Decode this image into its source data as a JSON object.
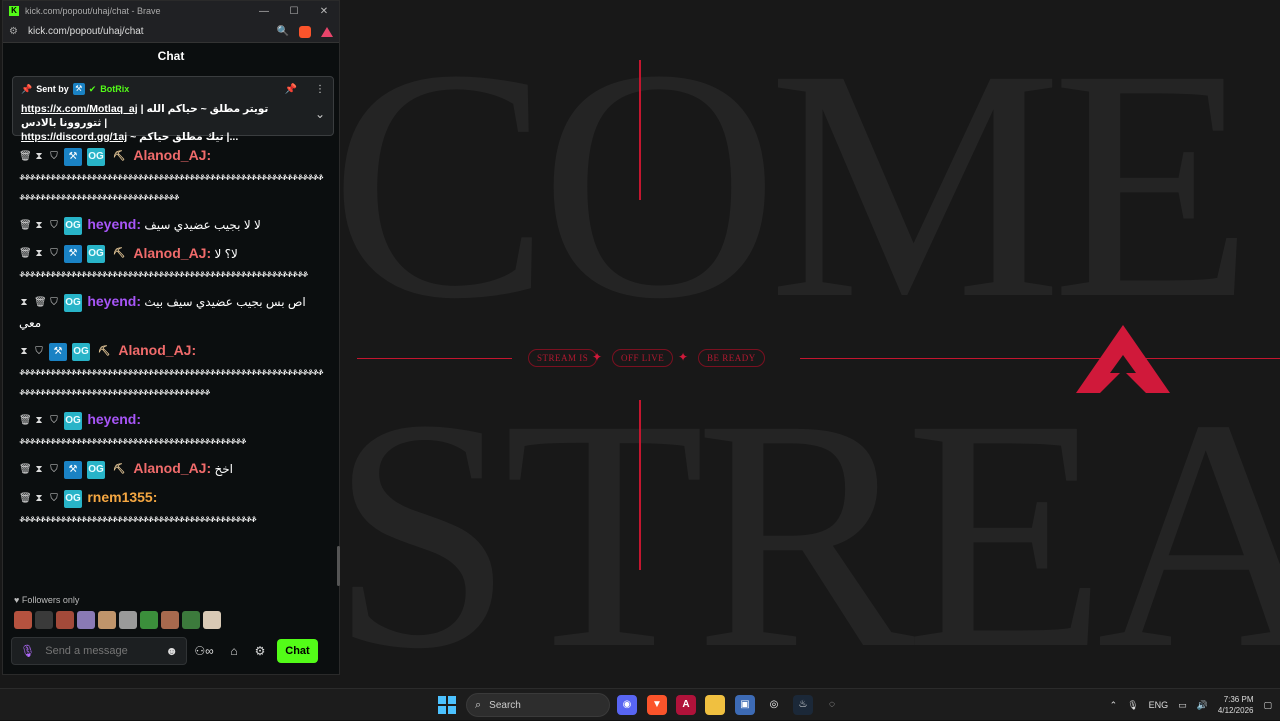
{
  "browser": {
    "window_title": "kick.com/popout/uhaj/chat - Brave",
    "url": "kick.com/popout/uhaj/chat",
    "window_controls": [
      "—",
      "☐",
      "✕"
    ]
  },
  "chat": {
    "header": "Chat",
    "pinned": {
      "sent_by_label": "Sent by",
      "bot_name": "BotRix",
      "line1_link": "https://x.com/Motlaq_aj",
      "line1_text": "| تويتر مطلق ~ حياكم الله ثتوروونا بالادس |",
      "line2_link": "https://discord.gg/1aj",
      "line2_text": "~ تيك مطلق حياكم |..."
    },
    "messages": [
      {
        "user": "Alanod_AJ",
        "text": "",
        "emotes": "ቆቆቆቆቆቆቆቆቆቆቆቆቆቆቆቆቆቆቆቆቆቆቆቆቆቆቆቆቆቆቆቆቆቆቆቆቆቆቆቆቆቆቆቆቆቆቆቆቆቆቆቆቆቆቆቆቆቆቆቆቆቆቆቆቆቆቆቆቆቆቆቆቆቆቆቆቆቆቆቆቆቆቆቆቆቆቆቆቆቆ"
      },
      {
        "user": "heyend",
        "text": "لا لا بجيب عضيدي سيف",
        "emotes": ""
      },
      {
        "user": "Alanod_AJ",
        "text": "لا؟ لا",
        "emotes": "ቆቆቆቆቆቆቆቆቆቆቆቆቆቆቆቆቆቆቆቆቆቆቆቆቆቆቆቆቆቆቆቆቆቆቆቆቆቆቆቆቆቆቆቆቆቆቆቆቆቆቆቆቆቆቆቆ"
      },
      {
        "user": "heyend",
        "text": "اص بس بجيب عضيدي سيف بيث معي",
        "emotes": ""
      },
      {
        "user": "Alanod_AJ",
        "text": "",
        "emotes": "ቆቆቆቆቆቆቆቆቆቆቆቆቆቆቆቆቆቆቆቆቆቆቆቆቆቆቆቆቆቆቆቆቆቆቆቆቆቆቆቆቆቆቆቆቆቆቆቆቆቆቆቆቆቆቆቆቆቆቆቆቆቆቆቆቆቆቆቆቆቆቆቆቆቆቆቆቆቆቆቆቆቆቆቆቆቆቆቆቆቆቆቆቆቆቆቆ"
      },
      {
        "user": "heyend",
        "text": "",
        "emotes": "ቆቆቆቆቆቆቆቆቆቆቆቆቆቆቆቆቆቆቆቆቆቆቆቆቆቆቆቆቆቆቆቆቆቆቆቆቆቆቆቆቆቆቆቆ"
      },
      {
        "user": "Alanod_AJ",
        "text": "اخخ",
        "emotes": ""
      },
      {
        "user": "rnem1355",
        "text": "",
        "emotes": "ቆቆቆቆቆቆቆቆቆቆቆቆቆቆቆቆቆቆቆቆቆቆቆቆቆቆቆቆቆቆቆቆቆቆቆቆቆቆቆቆቆቆቆቆቆቆ"
      }
    ],
    "followers_only": "Followers only",
    "input_placeholder": "Send a message",
    "chat_button": "Chat"
  },
  "stream_bg": {
    "big_text_1": "COME",
    "big_text_2": "STREA",
    "pills": [
      "STREAM IS",
      "OFF LIVE",
      "BE READY"
    ],
    "accent": "#d0193a"
  },
  "taskbar": {
    "search_label": "Search",
    "lang": "ENG",
    "time": "7:36 PM",
    "date": "4/12/2026"
  }
}
